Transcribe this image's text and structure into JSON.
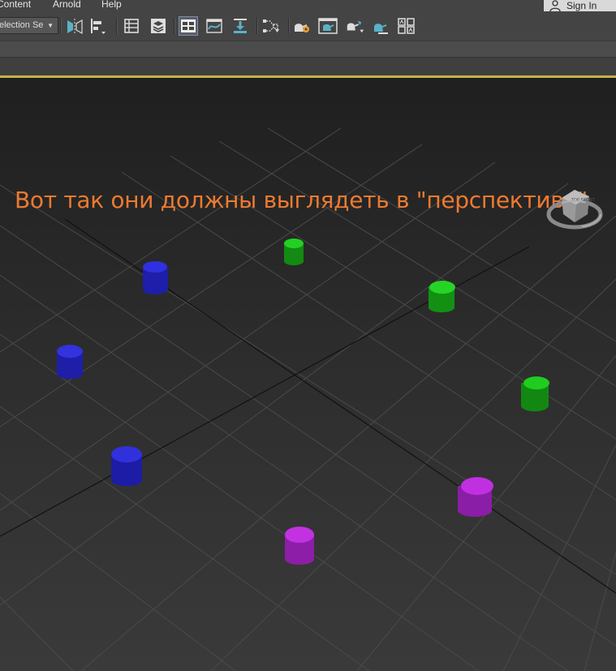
{
  "menu": {
    "items": [
      "Content",
      "Arnold",
      "Help"
    ],
    "sign_in": "Sign In"
  },
  "toolbar": {
    "selection_set": "election Se",
    "icons": [
      "mirror-icon",
      "align-icon",
      "layer-explorer-icon",
      "layers-icon",
      "scene-explorer-icon",
      "curve-editor-icon",
      "dope-sheet-icon",
      "schematic-view-icon",
      "render-setup-icon",
      "rendered-frame-window-icon",
      "render-icon",
      "render-production-icon",
      "render-iterative-icon"
    ]
  },
  "viewport": {
    "annotation": "Вот так они должны выглядеть в \"перспективе\"",
    "viewcube_label": "TOP FRONT"
  },
  "colors": {
    "accent_border": "#c6b24a",
    "annotation": "#ee7a30",
    "blue_cylinder": "#2a2ad8",
    "green_cylinder": "#1fbf1f",
    "magenta_cylinder": "#b02ad0"
  },
  "scene": {
    "cylinders": [
      {
        "color": "green"
      },
      {
        "color": "green"
      },
      {
        "color": "green"
      },
      {
        "color": "blue"
      },
      {
        "color": "blue"
      },
      {
        "color": "blue"
      },
      {
        "color": "magenta"
      },
      {
        "color": "magenta"
      }
    ]
  }
}
